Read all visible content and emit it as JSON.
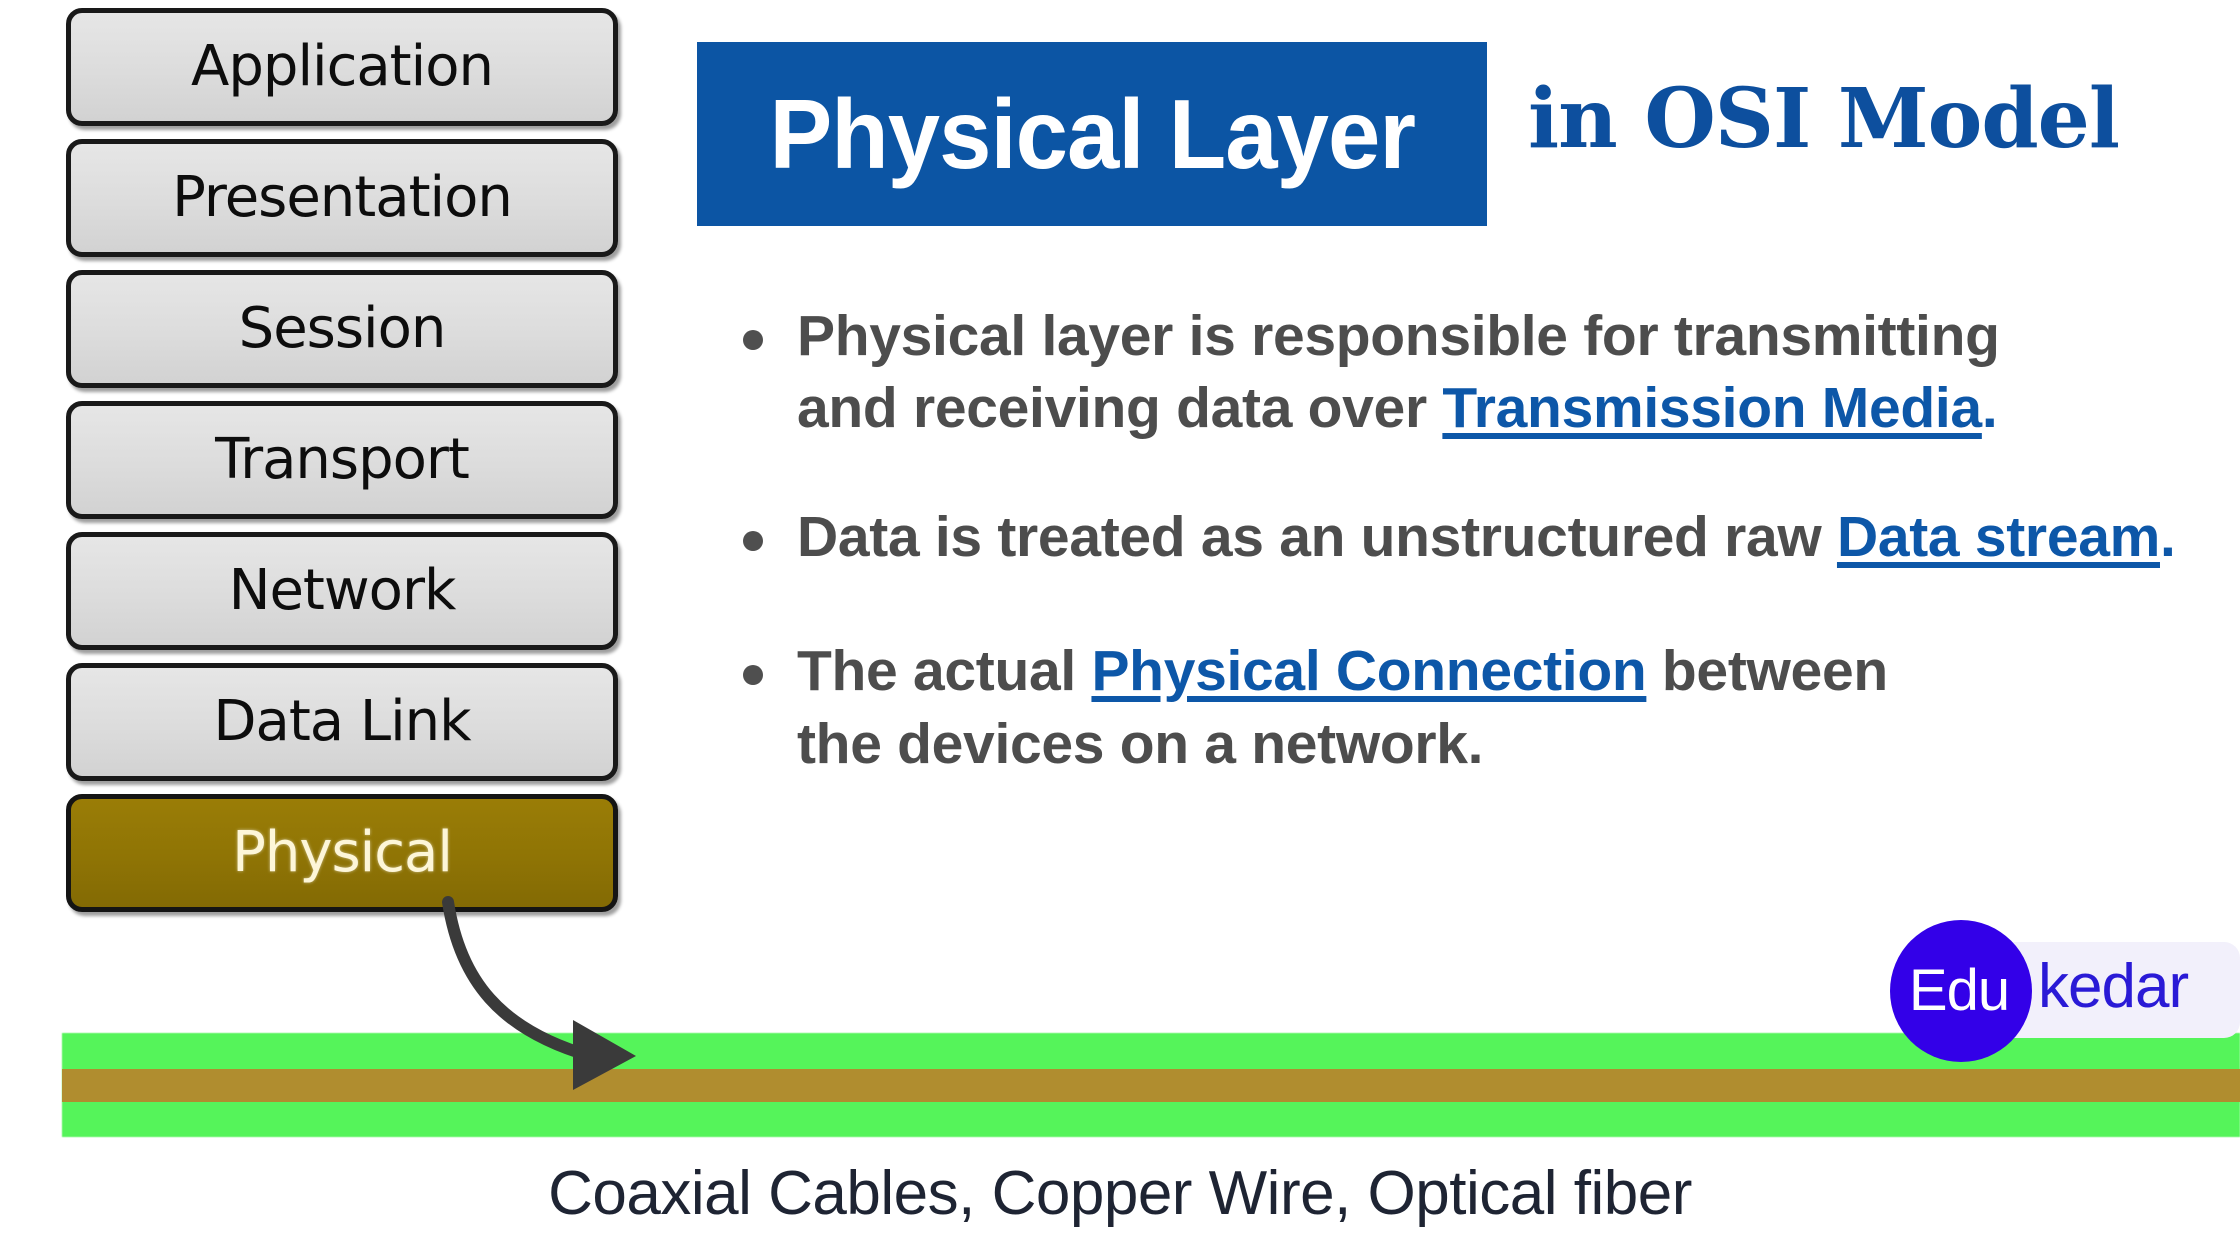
{
  "title": {
    "banner_text": "Physical Layer",
    "suffix_text": "in OSI Model",
    "banner_bg": "#0c55a4",
    "banner_fg": "#ffffff",
    "suffix_color": "#0d4f9e"
  },
  "osi_stack": {
    "highlight_color": "#8f7405",
    "layers": [
      {
        "name": "Application",
        "highlighted": false
      },
      {
        "name": "Presentation",
        "highlighted": false
      },
      {
        "name": "Session",
        "highlighted": false
      },
      {
        "name": "Transport",
        "highlighted": false
      },
      {
        "name": "Network",
        "highlighted": false
      },
      {
        "name": "Data Link",
        "highlighted": false
      },
      {
        "name": "Physical",
        "highlighted": true
      }
    ]
  },
  "bullets": [
    {
      "pre": "Physical layer is responsible for transmitting and receiving data over ",
      "link": "Transmission Media",
      "post": "."
    },
    {
      "pre": "Data is treated as an unstructured raw ",
      "link": "Data stream",
      "post": "."
    },
    {
      "pre": "The actual ",
      "link": "Physical Connection",
      "post": " between the devices on a network."
    }
  ],
  "cable": {
    "sheath_color": "#55f45a",
    "core_color": "#b08d2f",
    "caption": "Coaxial Cables, Copper Wire, Optical fiber"
  },
  "arrow": {
    "color": "#3a3a3a"
  },
  "logo": {
    "circle_text": "Edu",
    "plate_text": "kedar",
    "circle_color": "#3300e8",
    "plate_color": "#f2f0fb",
    "plate_text_color": "#2a1ad6"
  }
}
